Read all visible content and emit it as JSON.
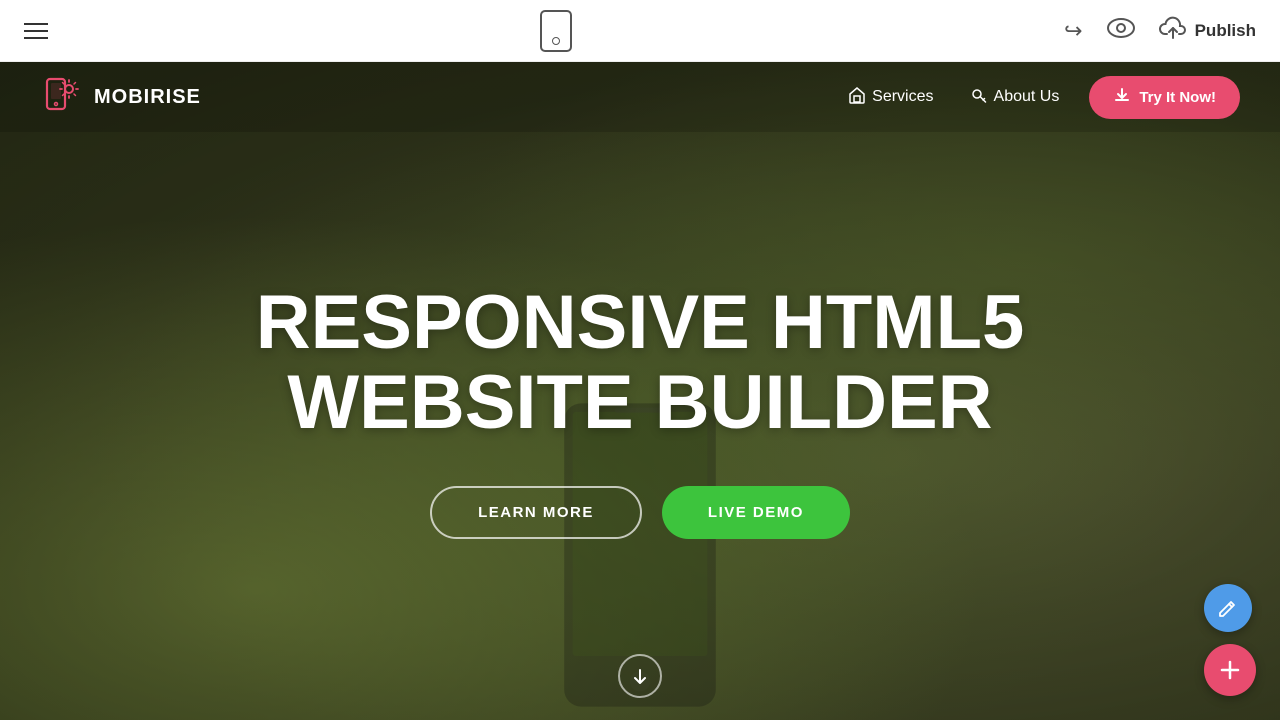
{
  "editorBar": {
    "hamburger_label": "menu",
    "undo_label": "undo",
    "preview_label": "preview",
    "publish_label": "Publish"
  },
  "siteNav": {
    "logo_text": "MOBIRISE",
    "services_label": "Services",
    "about_label": "About Us",
    "try_label": "Try It Now!"
  },
  "hero": {
    "title_line1": "RESPONSIVE HTML5",
    "title_line2": "WEBSITE BUILDER",
    "btn_learn": "LEARN MORE",
    "btn_demo": "LIVE DEMO"
  },
  "fab": {
    "edit_icon": "✎",
    "add_icon": "+"
  },
  "colors": {
    "accent_pink": "#e84c6f",
    "accent_green": "#3dc43d",
    "accent_blue": "#4f9be8"
  }
}
